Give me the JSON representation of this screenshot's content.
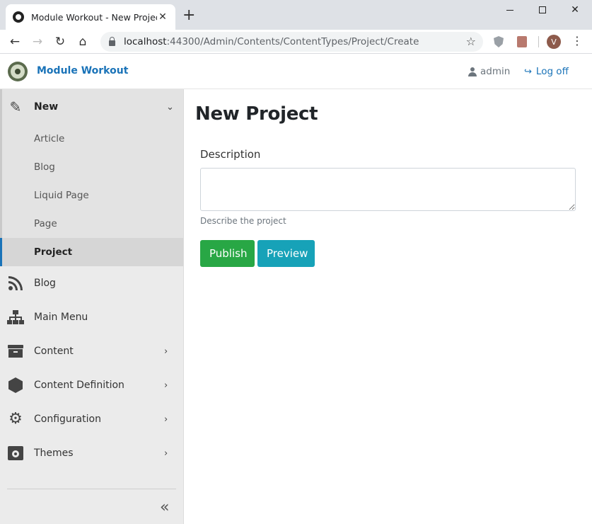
{
  "browser": {
    "tab_title": "Module Workout - New Project",
    "tab_close": "✕",
    "new_tab": "+",
    "url_host": "localhost",
    "url_rest": ":44300/Admin/Contents/ContentTypes/Project/Create",
    "profile_initial": "V",
    "icons": [
      "favicon",
      "close-icon",
      "plus-icon",
      "back-icon",
      "forward-icon",
      "reload-icon",
      "home-icon",
      "lock-icon",
      "star-icon",
      "shield-extension-icon",
      "pdf-extension-icon",
      "menu-icon"
    ]
  },
  "header": {
    "brand": "Module Workout",
    "user": "admin",
    "logoff": "Log off",
    "brand_color": "#1a73b8"
  },
  "sidebar": {
    "new_label": "New",
    "new_items": [
      {
        "label": "Article"
      },
      {
        "label": "Blog"
      },
      {
        "label": "Liquid Page"
      },
      {
        "label": "Page"
      },
      {
        "label": "Project",
        "active": true
      }
    ],
    "items": [
      {
        "label": "Blog",
        "icon": "rss-icon"
      },
      {
        "label": "Main Menu",
        "icon": "sitemap-icon"
      },
      {
        "label": "Content",
        "icon": "archive-icon",
        "has_submenu": true
      },
      {
        "label": "Content Definition",
        "icon": "cube-icon",
        "has_submenu": true
      },
      {
        "label": "Configuration",
        "icon": "gear-icon",
        "has_submenu": true
      },
      {
        "label": "Themes",
        "icon": "theme-icon",
        "has_submenu": true
      }
    ],
    "active_color": "#1a73b8"
  },
  "main": {
    "title": "New Project",
    "description_label": "Description",
    "description_value": "",
    "description_hint": "Describe the project",
    "publish": "Publish",
    "preview": "Preview",
    "publish_color": "#28a745",
    "preview_color": "#17a2b8"
  }
}
